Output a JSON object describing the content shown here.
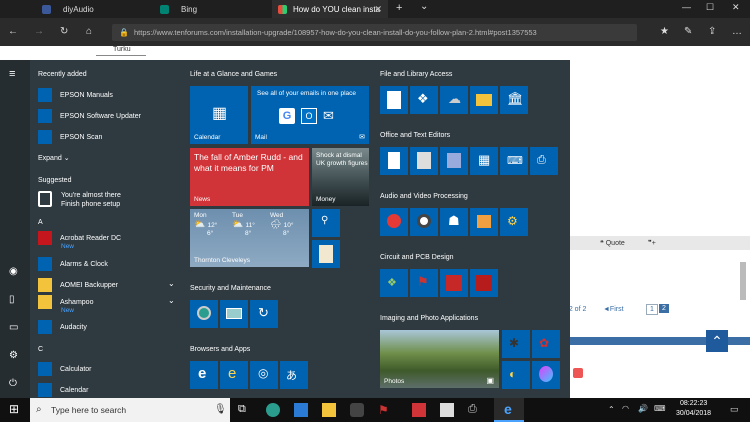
{
  "browser": {
    "tabs": [
      {
        "title": "diyAudio",
        "icon_color": "#3b5998"
      },
      {
        "title": "Bing",
        "icon_color": "#008373"
      },
      {
        "title": "How do YOU clean insta",
        "icon_color": "#e74c3c"
      }
    ],
    "new_tab_label": "+",
    "tab_menu_label": "⌄",
    "url": "https://www.tenforums.com/installation-upgrade/108957-how-do-you-clean-install-do-you-follow-plan-2.html#post1357553"
  },
  "page": {
    "top_text": "Turku",
    "quote_label": "Quote",
    "pagination": {
      "page_of": "e 2 of 2",
      "first_label": "◄First",
      "pages": [
        "1",
        "2"
      ]
    }
  },
  "start_menu": {
    "recently_added_header": "Recently added",
    "recent_apps": [
      "EPSON Manuals",
      "EPSON Software Updater",
      "EPSON Scan"
    ],
    "expand_label": "Expand",
    "suggested_header": "Suggested",
    "suggested_text_1": "You're almost there",
    "suggested_text_2": "Finish phone setup",
    "letter_a": "A",
    "apps_a": [
      {
        "name": "Acrobat Reader DC",
        "sub": "New"
      },
      {
        "name": "Alarms & Clock",
        "sub": ""
      },
      {
        "name": "AOMEI Backupper",
        "sub": ""
      },
      {
        "name": "Ashampoo",
        "sub": "New"
      },
      {
        "name": "Audacity",
        "sub": ""
      }
    ],
    "letter_c": "C",
    "apps_c": [
      "Calculator",
      "Calendar"
    ],
    "groups": {
      "life": "Life at a Glance and Games",
      "file": "File and Library Access",
      "office": "Office and Text Editors",
      "audio": "Audio and Video Processing",
      "circuit": "Circuit and PCB Design",
      "security": "Security and Maintenance",
      "imaging": "Imaging and Photo Applications",
      "browsers": "Browsers and Apps"
    },
    "tiles": {
      "calendar": "Calendar",
      "mail_text": "See all of your emails in one place",
      "mail": "Mail",
      "news_headline": "The fall of Amber Rudd - and what it means for PM",
      "news": "News",
      "money_headline": "Shock at dismal UK growth figures",
      "money": "Money",
      "weather": {
        "location": "Thornton Cleveleys",
        "days": [
          {
            "day": "Mon",
            "high": "12°",
            "low": "6°"
          },
          {
            "day": "Tue",
            "high": "11°",
            "low": "8°"
          },
          {
            "day": "Wed",
            "high": "10°",
            "low": "8°"
          }
        ]
      },
      "photos": "Photos"
    }
  },
  "taskbar": {
    "search_placeholder": "Type here to search",
    "time": "08:22:23",
    "date": "30/04/2018"
  },
  "colors": {
    "accent": "#0063b1",
    "news": "#d13438",
    "start_bg": "#2f3a40"
  }
}
